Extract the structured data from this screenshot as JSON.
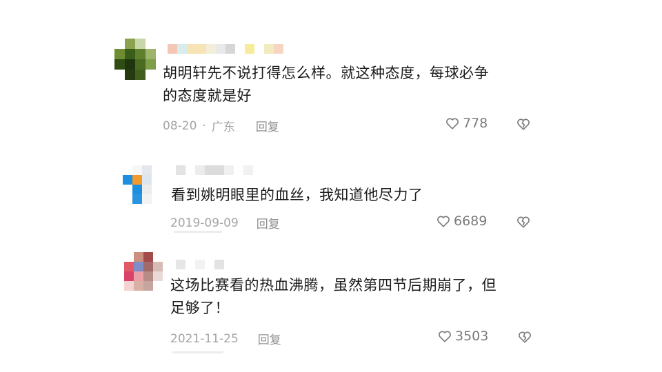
{
  "comments": [
    {
      "text_line1": "胡明轩先不说打得怎么样。就这种态度，每球必争",
      "text_line2": "的态度就是好",
      "date": "08-20",
      "separator": "·",
      "location": "广东",
      "reply_label": "回复",
      "likes": "778",
      "like_icon": "heart-outline-icon",
      "dislike_icon": "broken-heart-icon"
    },
    {
      "text_line1": "看到姚明眼里的血丝，我知道他尽力了",
      "date": "2019-09-09",
      "reply_label": "回复",
      "likes": "6689",
      "like_icon": "heart-outline-icon",
      "dislike_icon": "broken-heart-icon"
    },
    {
      "text_line1": "这场比赛看的热血沸腾，虽然第四节后期崩了，但",
      "text_line2": "足够了！",
      "date": "2021-11-25",
      "reply_label": "回复",
      "likes": "3503",
      "like_icon": "heart-outline-icon",
      "dislike_icon": "broken-heart-icon"
    }
  ],
  "colors": {
    "text": "#1b1b1b",
    "meta": "#a4a4a4",
    "likes": "#7a7a7a"
  }
}
